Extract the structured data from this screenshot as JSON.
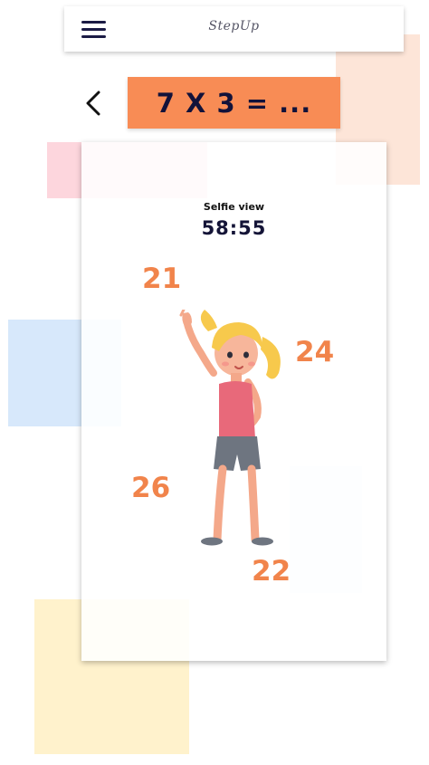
{
  "app": {
    "title": "StepUp"
  },
  "icons": {
    "menu": "hamburger-menu-icon",
    "back": "chevron-left-icon"
  },
  "question": {
    "text": "7 X 3 = ..."
  },
  "camera": {
    "label": "Selfie view",
    "timer": "58:55"
  },
  "answers": [
    "21",
    "24",
    "26",
    "22"
  ],
  "colors": {
    "accent": "#f88c55",
    "answer_text": "#f1844b",
    "dark_text": "#141437",
    "deco_peach": "#fde5d8",
    "deco_pink": "#fdd6dd",
    "deco_blue": "#d7e8fb",
    "deco_yellow": "#fff2cc"
  }
}
